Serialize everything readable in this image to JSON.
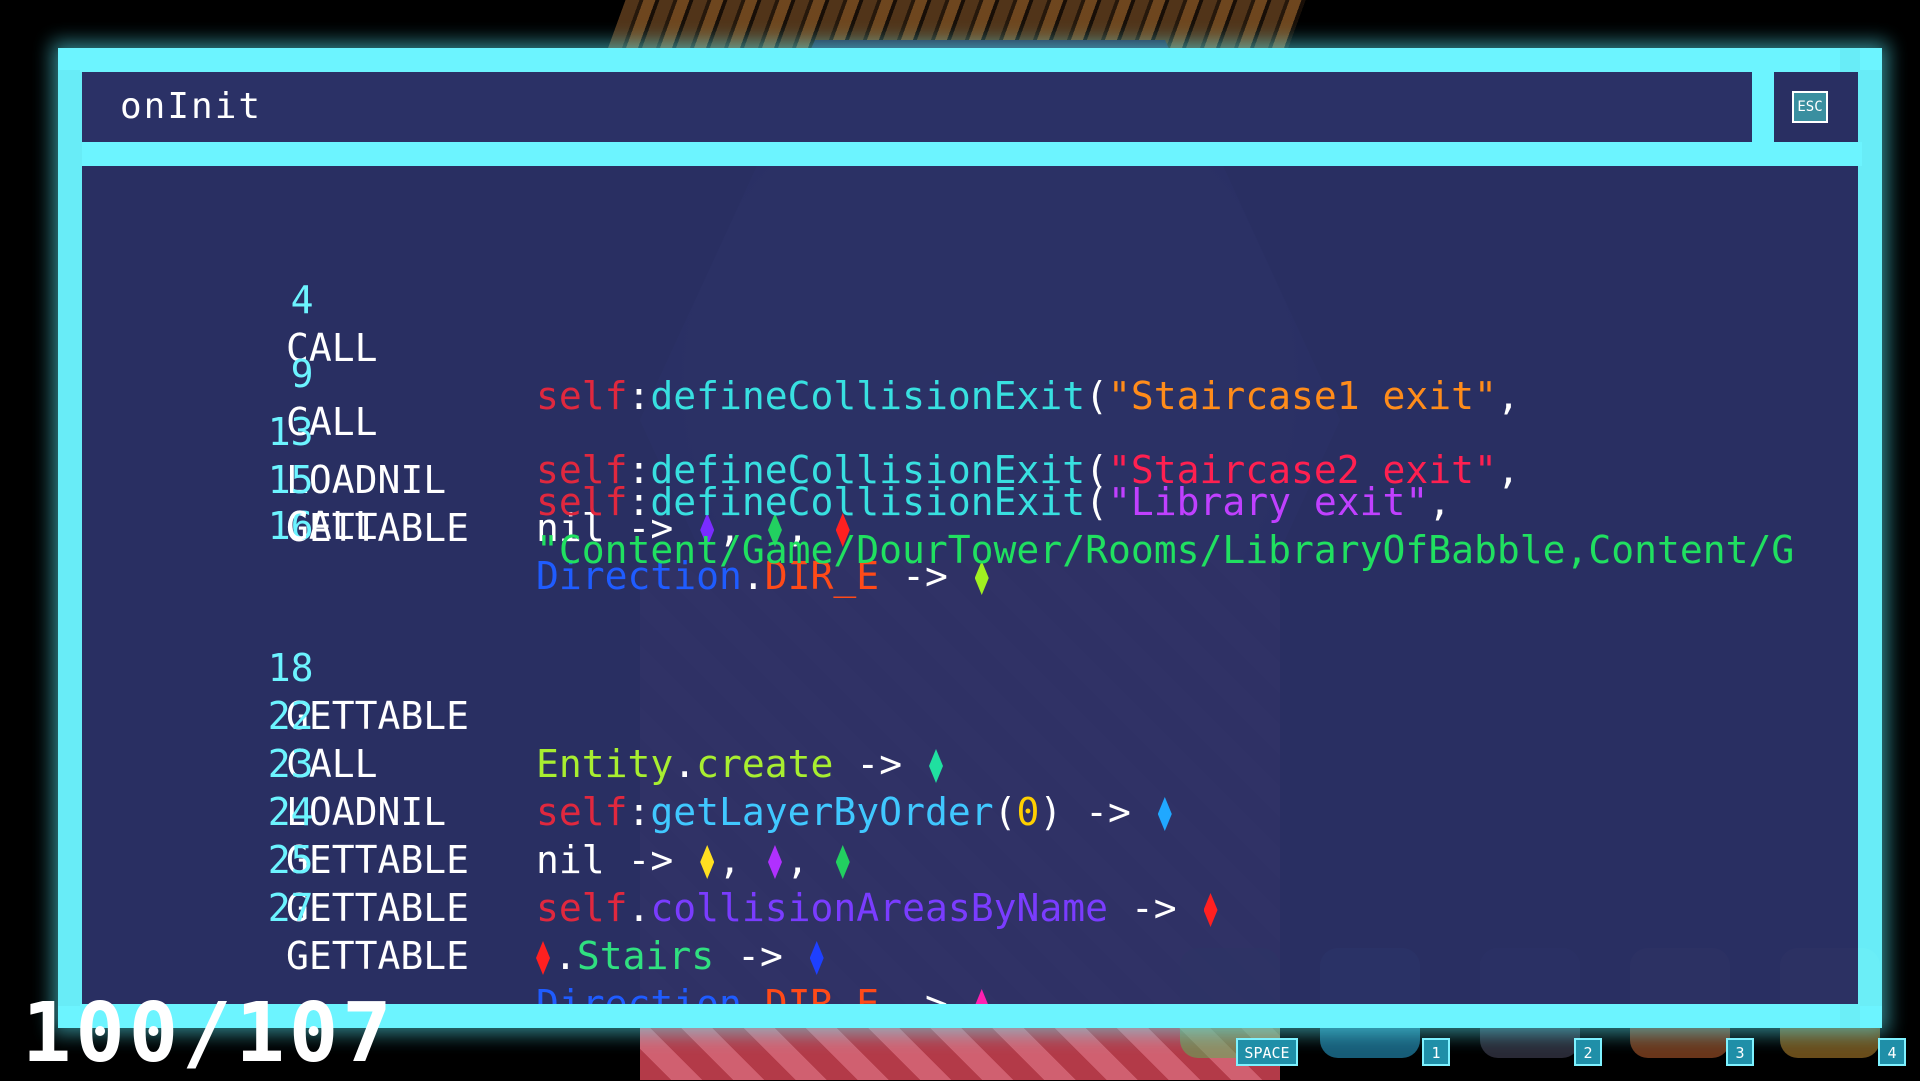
{
  "window": {
    "title": "onInit",
    "close_label": "ESC"
  },
  "code_lines": [
    {
      "num": "4",
      "op": "CALL"
    },
    {
      "num": "9",
      "op": "CALL"
    },
    {
      "num": "13",
      "op": "LOADNIL"
    },
    {
      "num": "15",
      "op": "GETTABLE"
    },
    {
      "num": "16",
      "op": "CALL"
    },
    {
      "num": "18",
      "op": "GETTABLE"
    },
    {
      "num": "22",
      "op": "CALL"
    },
    {
      "num": "23",
      "op": "LOADNIL"
    },
    {
      "num": "24",
      "op": "GETTABLE"
    },
    {
      "num": "25",
      "op": "GETTABLE"
    },
    {
      "num": "27",
      "op": "GETTABLE"
    }
  ],
  "tokens": {
    "self": "self",
    "colon": ":",
    "dot": ".",
    "define_fn": "defineCollisionExit",
    "open_paren": "(",
    "close_paren": ")",
    "comma": ",",
    "str1": "\"Staircase1 exit\"",
    "str2": "\"Staircase2 exit\"",
    "str3": "\"Library exit\"",
    "path_str": "\"Content/Game/DourTower/Rooms/LibraryOfBabble,Content/G",
    "nil": "nil",
    "arrow": "->",
    "direction": "Direction",
    "dir_e": "DIR_E",
    "entity": "Entity",
    "create": "create",
    "get_layer": "getLayerByOrder",
    "zero": "0",
    "collision_areas": "collisionAreasByName",
    "stairs": "Stairs"
  },
  "gem_colors": {
    "violet": "#7a2cff",
    "green": "#22d060",
    "red": "#ff2020",
    "lime": "#a0f020",
    "teal": "#20e0a0",
    "sky": "#20a8ff",
    "yellow": "#ffe020",
    "purple": "#b030ff",
    "blue": "#1e40ff",
    "magenta": "#ff20b0"
  },
  "hud": {
    "score": "100/107",
    "hotkeys": [
      "SPACE",
      "1",
      "2",
      "3",
      "4"
    ]
  },
  "theme": {
    "frame": "#6cf4ff",
    "panel": "#2b3166"
  }
}
